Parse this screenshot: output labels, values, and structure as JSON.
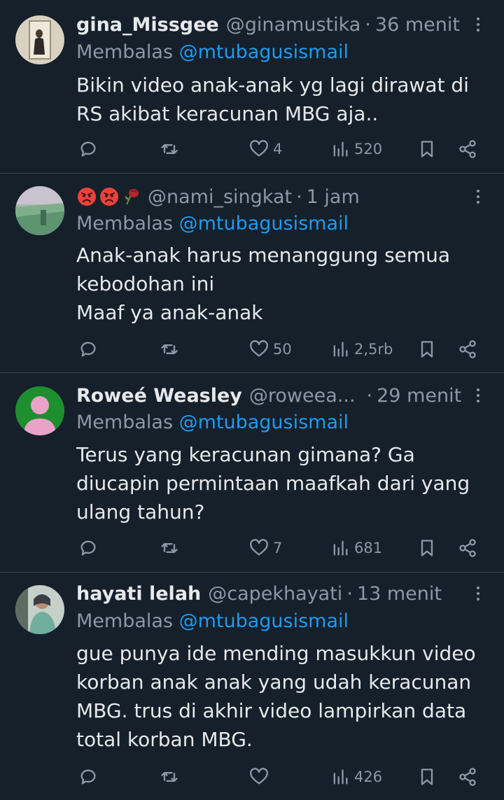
{
  "replies": [
    {
      "name": "gina_Missgee",
      "handle": "@ginamustika",
      "time": "36 menit",
      "replying_prefix": "Membalas",
      "replying_to": "@mtubagusismail",
      "text": "Bikin video anak-anak yg lagi dirawat di\nRS akibat keracunan MBG aja..",
      "likes": "4",
      "views": "520"
    },
    {
      "name": "",
      "name_emojis": [
        "pouting-face",
        "pouting-face",
        "wilted-rose"
      ],
      "handle": "@nami_singkat",
      "time": "1 jam",
      "replying_prefix": "Membalas",
      "replying_to": "@mtubagusismail",
      "text": "Anak-anak harus menanggung semua\nkebodohan ini\nMaaf ya anak-anak",
      "likes": "50",
      "views": "2,5rb"
    },
    {
      "name": "Roweé Weasley",
      "handle": "@roweea...",
      "time": "29 menit",
      "replying_prefix": "Membalas",
      "replying_to": "@mtubagusismail",
      "text": "Terus yang keracunan gimana? Ga\ndiucapin permintaan maafkah dari yang\nulang tahun?",
      "likes": "7",
      "views": "681"
    },
    {
      "name": "hayati lelah",
      "handle": "@capekhayati",
      "time": "13 menit",
      "replying_prefix": "Membalas",
      "replying_to": "@mtubagusismail",
      "text": "gue punya ide mending masukkun video\nkorban anak anak yang udah keracunan\nMBG. trus di akhir video lampirkan data\ntotal korban MBG.",
      "likes": "",
      "views": "426"
    }
  ],
  "separator": "·",
  "colors": {
    "background": "#15202b",
    "text": "#e7e9ea",
    "muted": "#8b98a5",
    "link": "#1d9bf0",
    "divider": "#38444d"
  },
  "icons": [
    "reply-icon",
    "retweet-icon",
    "heart-icon",
    "views-icon",
    "bookmark-icon",
    "share-icon",
    "more-icon"
  ]
}
